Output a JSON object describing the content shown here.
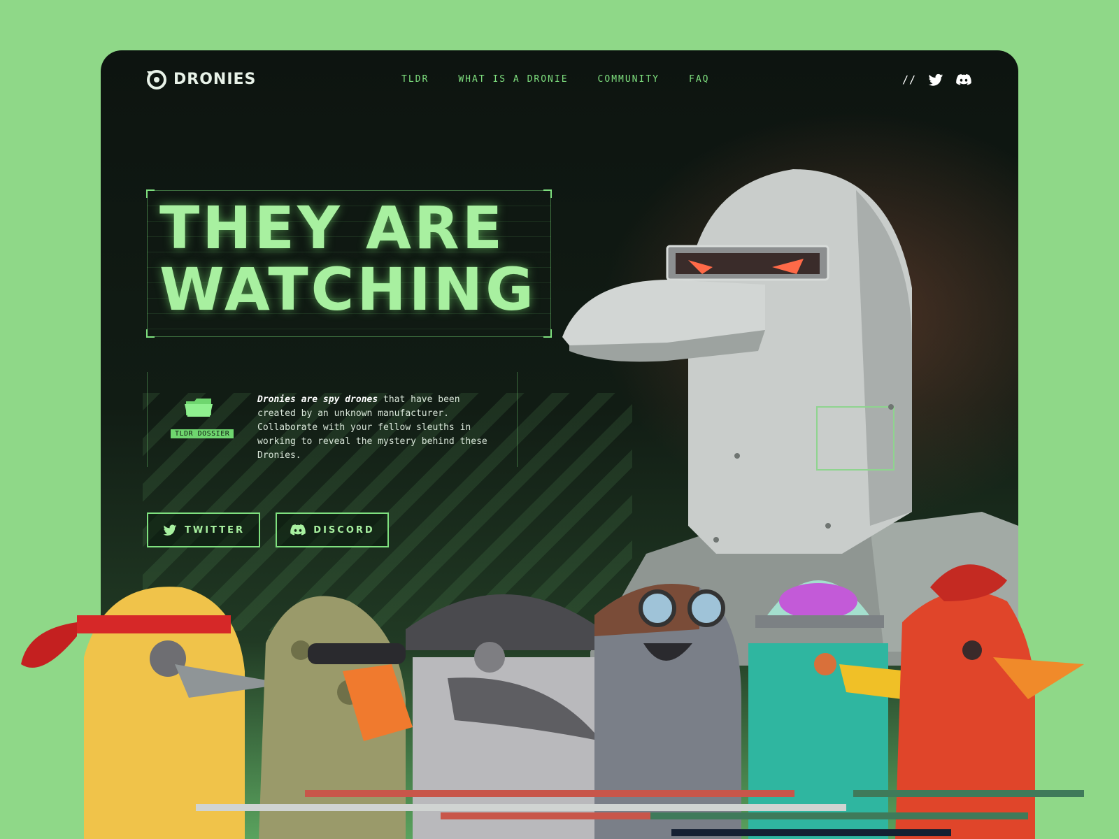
{
  "brand": {
    "name": "DRONIES",
    "logo_icon": "dronies-logo-icon"
  },
  "nav": {
    "items": [
      {
        "label": "TLDR"
      },
      {
        "label": "WHAT IS A DRONIE"
      },
      {
        "label": "COMMUNITY"
      },
      {
        "label": "FAQ"
      }
    ]
  },
  "social": {
    "separator": "//",
    "icons": [
      "twitter-icon",
      "discord-icon"
    ]
  },
  "hero": {
    "headline_line1": "THEY ARE",
    "headline_line2": "WATCHING"
  },
  "dossier": {
    "label": "TLDR DOSSIER",
    "intro_emphasis": "Dronies are spy drones",
    "intro_rest": " that have been created by an unknown manufacturer. Collaborate with your fellow sleuths in working to reveal the mystery behind these Dronies."
  },
  "cta": {
    "twitter_label": "TWITTER",
    "discord_label": "DISCORD"
  },
  "colors": {
    "page_bg": "#8fd888",
    "accent": "#7fe07f",
    "headline": "#a8f0a0",
    "card_bg": "#0d1410"
  }
}
